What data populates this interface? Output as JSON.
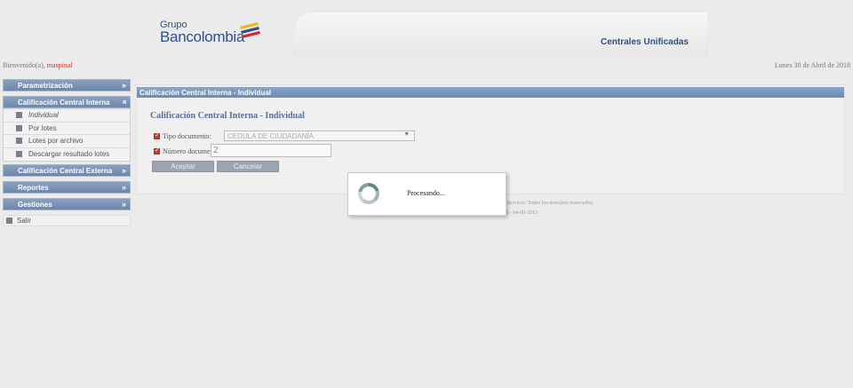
{
  "header": {
    "logo_line1": "Grupo",
    "logo_line2": "Bancolombia",
    "banner_title": "Centrales Unificadas"
  },
  "welcome": {
    "prefix": "Bienvenido(a),",
    "user": "maspinal"
  },
  "date": "Lunes 30 de Abril de 2018",
  "sidebar": {
    "sections": [
      {
        "label": "Parametrización",
        "icon": "chevron-down-double"
      },
      {
        "label": "Calificación Central Interna",
        "icon": "chevron-up-double",
        "items": [
          "Individual",
          "Por lotes",
          "Lotes por archivo",
          "Descargar resultado lotes"
        ]
      },
      {
        "label": "Calificación Central Externa",
        "icon": "chevron-down-double"
      },
      {
        "label": "Reportes",
        "icon": "chevron-down-double"
      },
      {
        "label": "Gestiones",
        "icon": "chevron-down-double"
      }
    ],
    "salir": "Salir"
  },
  "panel": {
    "header": "Calificación Central Interna - Individual",
    "title": "Calificación Central Interna - Individual",
    "tipo_label": "Tipo documento:",
    "tipo_value": "CEDULA DE CIUDADANÍA",
    "numero_label": "Número documento:",
    "numero_value": "2",
    "accept": "Aceptar",
    "cancel": "Cancelar"
  },
  "footer": {
    "line1": "y Services. Todos los derechos reservados.",
    "line2": "10 - 04-06-2013"
  },
  "dialog": {
    "message": "Procesando..."
  },
  "colors": {
    "accent": "#6f86ab",
    "brand": "#2e4f86",
    "user": "#c0392b"
  }
}
